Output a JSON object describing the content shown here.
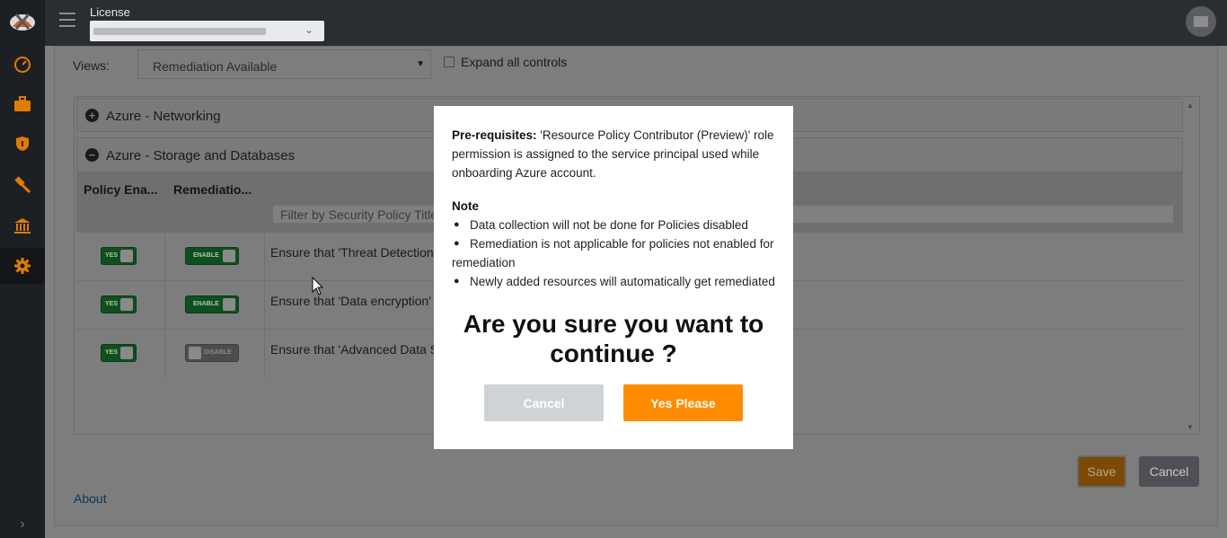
{
  "topbar": {
    "license_label": "License",
    "license_select_value": "",
    "avatar_icon": "user-avatar"
  },
  "sidebar": {
    "items": [
      {
        "icon": "speedometer-icon",
        "active": false
      },
      {
        "icon": "briefcase-icon",
        "active": false
      },
      {
        "icon": "shield-icon",
        "active": false
      },
      {
        "icon": "gavel-icon",
        "active": false
      },
      {
        "icon": "bank-icon",
        "active": false
      },
      {
        "icon": "gear-icon",
        "active": true
      }
    ],
    "accent_color": "#ff8c00"
  },
  "main": {
    "views_label": "Views:",
    "views_value": "Remediation Available",
    "expand_all_label": "Expand all controls",
    "sections": [
      {
        "sign": "+",
        "title": "Azure - Networking"
      },
      {
        "sign": "−",
        "title": "Azure - Storage and Databases"
      }
    ],
    "columns": [
      "Policy Ena...",
      "Remediatio..."
    ],
    "filter_placeholder": "Filter by Security Policy Title",
    "rows": [
      {
        "policy": "YES",
        "remediation": "ENABLE",
        "title": "Ensure that 'Threat Detection"
      },
      {
        "policy": "YES",
        "remediation": "ENABLE",
        "title": "Ensure that 'Data encryption'"
      },
      {
        "policy": "YES",
        "remediation": "DISABLE",
        "title": "Ensure that 'Advanced Data Se"
      }
    ],
    "save_label": "Save",
    "cancel_label": "Cancel",
    "about_label": "About"
  },
  "modal": {
    "prereq_label": "Pre-requisites:",
    "prereq_text": " 'Resource Policy Contributor (Preview)' role permission is assigned to the service principal used while onboarding Azure account.",
    "note_label": "Note",
    "notes": [
      "Data collection will not be done for Policies disabled",
      "Remediation is not applicable for policies not enabled for remediation",
      "Newly added resources will automatically get remediated"
    ],
    "question": "Are you sure you want to continue ?",
    "cancel_label": "Cancel",
    "confirm_label": "Yes Please",
    "confirm_color": "#ff8c00"
  }
}
